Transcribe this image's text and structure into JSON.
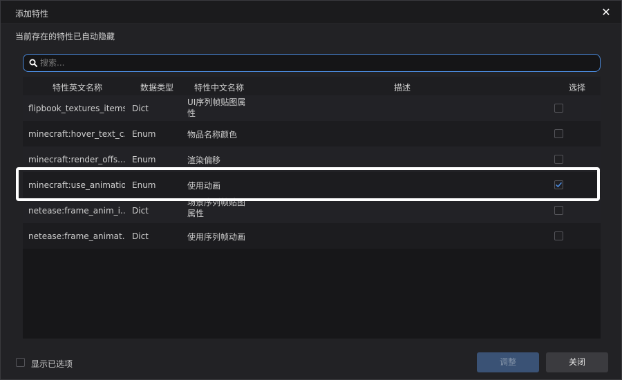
{
  "dialog": {
    "title": "添加特性",
    "close_icon": "close-icon",
    "subtitle": "当前存在的特性已自动隐藏"
  },
  "search": {
    "placeholder": "搜索...",
    "value": "",
    "icon": "search-icon"
  },
  "table": {
    "columns": [
      "特性英文名称",
      "数据类型",
      "特性中文名称",
      "描述",
      "选择"
    ],
    "rows": [
      {
        "name": "flipbook_textures_items",
        "type": "Dict",
        "cn": "UI序列帧贴图属性",
        "desc": "",
        "checked": false
      },
      {
        "name": "minecraft:hover_text_c...",
        "type": "Enum",
        "cn": "物品名称颜色",
        "desc": "",
        "checked": false
      },
      {
        "name": "minecraft:render_offs...",
        "type": "Enum",
        "cn": "渲染偏移",
        "desc": "",
        "checked": false
      },
      {
        "name": "minecraft:use_animation",
        "type": "Enum",
        "cn": "使用动画",
        "desc": "",
        "checked": true
      },
      {
        "name": "netease:frame_anim_i...",
        "type": "Dict",
        "cn": "场景序列帧贴图属性",
        "desc": "",
        "checked": false
      },
      {
        "name": "netease:frame_animat...",
        "type": "Dict",
        "cn": "使用序列帧动画",
        "desc": "",
        "checked": false
      }
    ]
  },
  "footer": {
    "show_selected_label": "显示已选项",
    "show_selected_checked": false,
    "adjust_label": "调整",
    "close_label": "关闭"
  },
  "colors": {
    "accent": "#4a88d9",
    "check": "#4a88d9"
  }
}
